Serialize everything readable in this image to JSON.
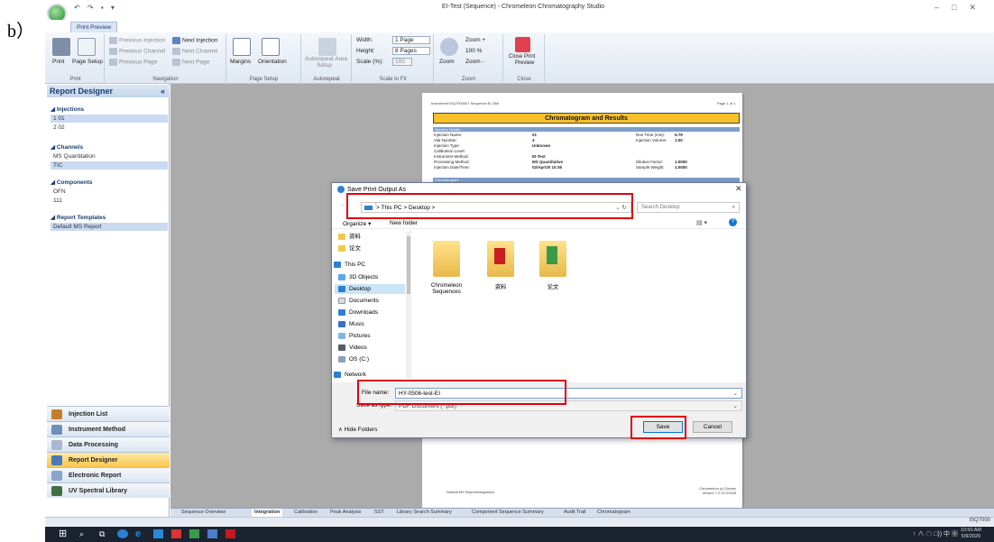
{
  "label_b": "b）",
  "window": {
    "title": "EI-Test (Sequence) - Chromeleon Chromatography Studio",
    "minimize": "–",
    "restore": "□",
    "close": "✕"
  },
  "ribbon_tab": "Print Preview",
  "ribbon": {
    "print": {
      "print_label": "Print",
      "page_setup_label": "Page Setup",
      "caption": "Print"
    },
    "navigation": {
      "prev_injection": "Previous Injection",
      "next_injection": "Next Injection",
      "prev_channel": "Previous Channel",
      "next_channel": "Next Channel",
      "prev_page": "Previous Page",
      "next_page": "Next Page",
      "caption": "Navigation"
    },
    "page_setup": {
      "margins": "Margins",
      "orientation": "Orientation",
      "caption": "Page Setup"
    },
    "autorepeat": {
      "area_setup_1": "Autorepeat Area",
      "area_setup_2": "Setup",
      "caption": "Autorepeat"
    },
    "scale": {
      "width_label": "Width:",
      "width_value": "1 Page",
      "height_label": "Height:",
      "height_value": "8 Pages",
      "scale_label": "Scale (%):",
      "scale_value": "100",
      "caption": "Scale to Fit"
    },
    "zoom": {
      "zoom_label": "Zoom",
      "zoom_in": "Zoom +",
      "zoom_100": "100 %",
      "zoom_out": "Zoom -",
      "caption": "Zoom"
    },
    "close": {
      "close_1": "Close Print",
      "close_2": "Preview",
      "caption": "Close"
    }
  },
  "report_designer": {
    "title": "Report Designer",
    "collapse": "«",
    "injections_header": "Injections",
    "injections": [
      "1 01",
      "2 02"
    ],
    "channels_header": "Channels",
    "channels": [
      "MS Quantitation",
      "TIC"
    ],
    "components_header": "Components",
    "components": [
      "OFN",
      "111"
    ],
    "templates_header": "Report Templates",
    "templates": [
      "Default MS Report"
    ]
  },
  "nav_buttons": [
    "Injection List",
    "Instrument Method",
    "Data Processing",
    "Report Designer",
    "Electronic Report",
    "UV Spectral Library"
  ],
  "preview": {
    "header_left": "Instrument:ISQ7000007   Sequence:EI-Test",
    "header_right": "Page 1 of 1",
    "banner": "Chromatogram and Results",
    "section_injection": "Injection Details",
    "details": [
      {
        "k": "Injection Name:",
        "v": "01",
        "k2": "Run Time (min):",
        "v2": "5.79"
      },
      {
        "k": "Vial Number:",
        "v": "3",
        "k2": "Injection Volume:",
        "v2": "1.00"
      },
      {
        "k": "Injection Type:",
        "v": "Unknown",
        "k2": "",
        "v2": ""
      },
      {
        "k": "Calibration Level:",
        "v": "",
        "k2": "",
        "v2": ""
      },
      {
        "k": "Instrument Method:",
        "v": "EI-Test",
        "k2": "",
        "v2": ""
      },
      {
        "k": "Processing Method:",
        "v": "MS Quantitative",
        "k2": "Dilution Factor:",
        "v2": "1.0000"
      },
      {
        "k": "Injection Date/Time:",
        "v": "02/Apr/20 10:36",
        "k2": "Sample Weight:",
        "v2": "1.0000"
      }
    ],
    "section_chromatogram": "Chromatogram",
    "footer_left": "Default MS Report/Integration",
    "footer_right_1": "Chromeleon (c) Dionex",
    "footer_right_2": "Version 7.2.10.23925"
  },
  "bottom_tabs": [
    "Sequence Overview",
    "Integration",
    "Calibration",
    "Peak Analysis",
    "SST",
    "Library Search Summary",
    "Component Sequence Summary",
    "Audit Trail",
    "Chromatogram"
  ],
  "status_right": "ISQ7000",
  "tray": {
    "text": "↑ ∧ ☁ □)) 中 ▦",
    "time": "10:50 AM",
    "date": "5/9/2020"
  },
  "dialog": {
    "title": "Save Print Output As",
    "close": "✕",
    "nav": "← → ↑",
    "address": "> This PC > Desktop >",
    "search_placeholder": "Search Desktop",
    "organize": "Organize ▾",
    "new_folder": "New folder",
    "nav_items": [
      "资料",
      "论文",
      "This PC",
      "3D Objects",
      "Desktop",
      "Documents",
      "Downloads",
      "Music",
      "Pictures",
      "Videos",
      "OS (C:)",
      "Network"
    ],
    "folders": [
      {
        "name_1": "Chromeleon",
        "name_2": "Sequences"
      },
      {
        "name_1": "资料",
        "name_2": ""
      },
      {
        "name_1": "论文",
        "name_2": ""
      }
    ],
    "file_name_label": "File name:",
    "file_name_value": "HY-0506-test-EI",
    "save_type_label": "Save as type:",
    "save_type_value": "PDF Document (*.pdf)",
    "hide_folders": "∧ Hide Folders",
    "save": "Save",
    "cancel": "Cancel"
  }
}
